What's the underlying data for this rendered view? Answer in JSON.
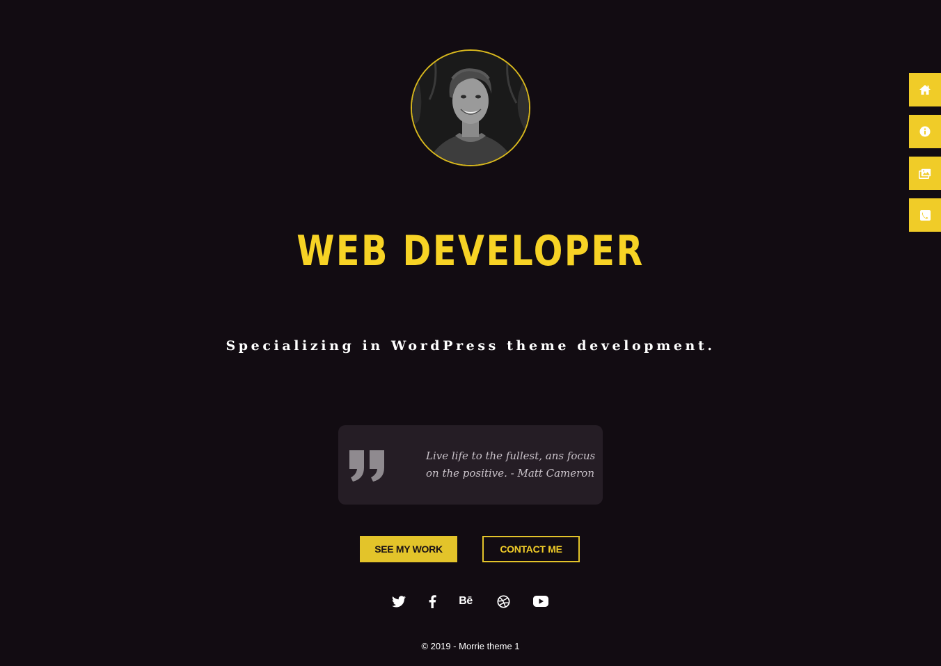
{
  "hero": {
    "title": "WEB DEVELOPER",
    "subtitle": "Specializing in WordPress theme development."
  },
  "quote": {
    "text": "Live life to the fullest, ans focus on the positive. - Matt Cameron"
  },
  "buttons": {
    "see_work": "SEE MY WORK",
    "contact": "CONTACT ME"
  },
  "social": {
    "items": [
      {
        "icon": "twitter-icon"
      },
      {
        "icon": "facebook-icon"
      },
      {
        "icon": "behance-icon",
        "label": "Bē"
      },
      {
        "icon": "dribbble-icon"
      },
      {
        "icon": "youtube-icon"
      }
    ]
  },
  "footer": {
    "text": "© 2019 - Morrie theme 1"
  },
  "side_nav": {
    "items": [
      {
        "icon": "home-icon"
      },
      {
        "icon": "info-icon"
      },
      {
        "icon": "gallery-icon"
      },
      {
        "icon": "contact-icon"
      }
    ]
  },
  "colors": {
    "background": "#120c12",
    "accent": "#f0cc28",
    "quote_box": "#251d25"
  }
}
